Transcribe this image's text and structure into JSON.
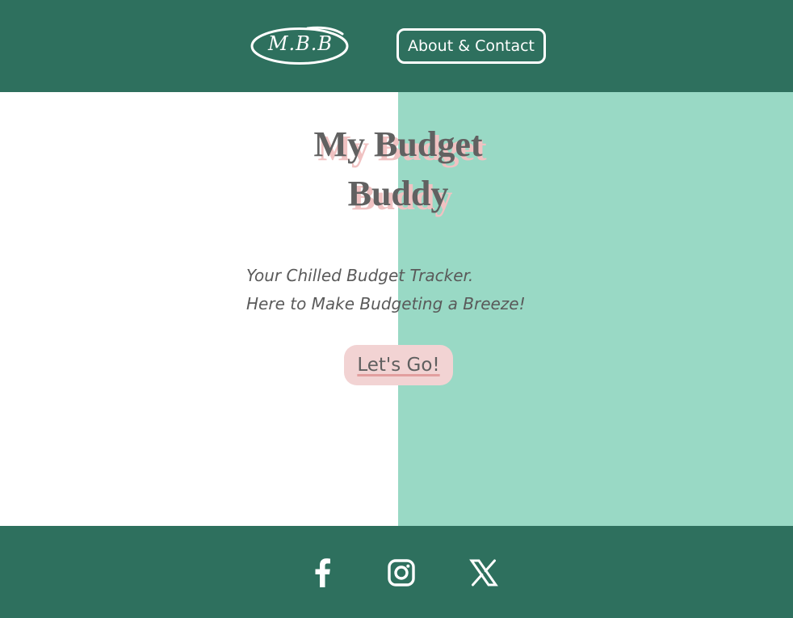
{
  "header": {
    "logo_text": "M.B.B",
    "nav": {
      "about_contact_label": "About & Contact"
    }
  },
  "hero": {
    "title_line1": "My Budget",
    "title_line2": "Buddy",
    "tagline_line1": "Your Chilled Budget Tracker.",
    "tagline_line2": "Here to Make Budgeting a Breeze!",
    "cta_label": "Let's Go!"
  },
  "footer": {
    "social_icons": [
      "facebook-icon",
      "instagram-icon",
      "x-icon"
    ]
  },
  "colors": {
    "header_footer_bg": "#2e705e",
    "accent_panel": "#99d9c5",
    "title_text": "#616161",
    "title_shadow": "#f0c2c2",
    "cta_bg": "#f2d3d3",
    "white": "#ffffff"
  }
}
